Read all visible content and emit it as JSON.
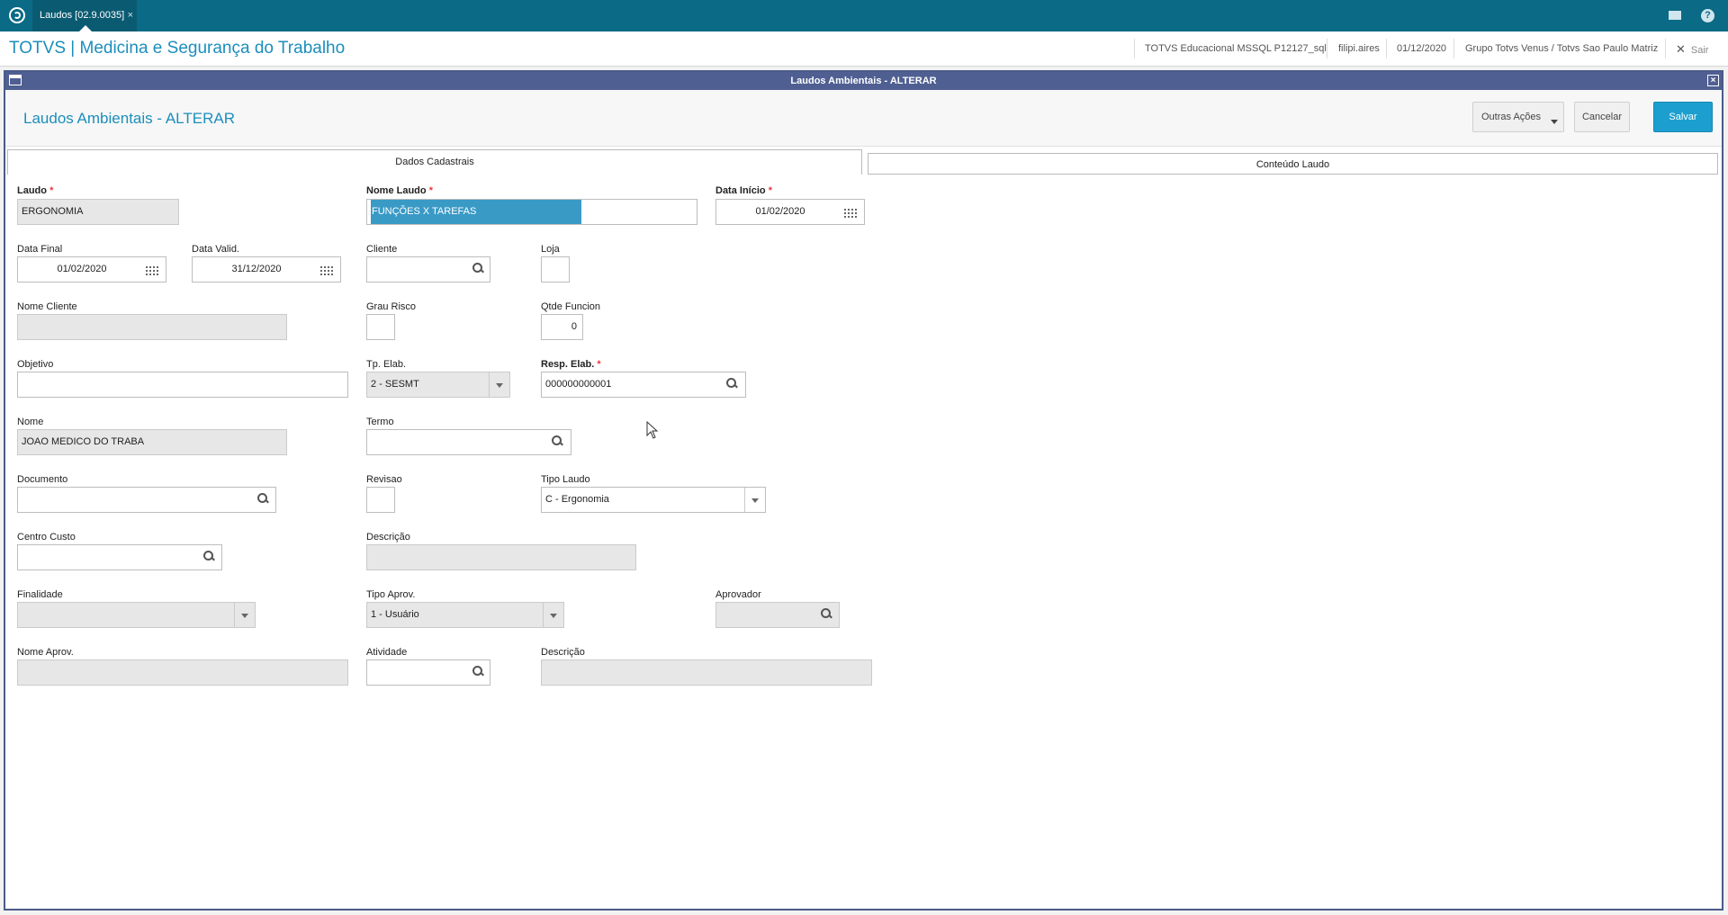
{
  "topbar": {
    "tab_label": "Laudos [02.9.0035]",
    "tab_close": "×",
    "help": "?"
  },
  "header": {
    "app_title": "TOTVS | Medicina e Segurança do Trabalho",
    "env": "TOTVS Educacional MSSQL P12127_sql",
    "user": "filipi.aires",
    "date": "01/12/2020",
    "company": "Grupo Totvs Venus / Totvs Sao Paulo Matriz",
    "exit_label": "Sair",
    "exit_x": "✕"
  },
  "window": {
    "title": "Laudos Ambientais - ALTERAR",
    "close": "×"
  },
  "page": {
    "title": "Laudos Ambientais - ALTERAR",
    "btn_outras": "Outras Ações",
    "btn_cancel": "Cancelar",
    "btn_save": "Salvar"
  },
  "tabs": {
    "dados": "Dados Cadastrais",
    "conteudo": "Conteúdo Laudo"
  },
  "form": {
    "laudo": {
      "label": "Laudo",
      "value": "ERGONOMIA"
    },
    "nome_laudo": {
      "label": "Nome Laudo",
      "value": "FUNÇÕES X TAREFAS"
    },
    "data_inicio": {
      "label": "Data Início",
      "value": "01/02/2020"
    },
    "data_final": {
      "label": "Data Final",
      "value": "01/02/2020"
    },
    "data_valid": {
      "label": "Data Valid.",
      "value": "31/12/2020"
    },
    "cliente": {
      "label": "Cliente",
      "value": ""
    },
    "loja": {
      "label": "Loja",
      "value": ""
    },
    "nome_cliente": {
      "label": "Nome Cliente",
      "value": ""
    },
    "grau_risco": {
      "label": "Grau Risco",
      "value": ""
    },
    "qtde_funcion": {
      "label": "Qtde Funcion",
      "value": "0"
    },
    "objetivo": {
      "label": "Objetivo",
      "value": ""
    },
    "tp_elab": {
      "label": "Tp. Elab.",
      "value": "2 - SESMT"
    },
    "resp_elab": {
      "label": "Resp. Elab.",
      "value": "000000000001"
    },
    "nome": {
      "label": "Nome",
      "value": "JOAO MEDICO DO TRABA"
    },
    "termo": {
      "label": "Termo",
      "value": ""
    },
    "documento": {
      "label": "Documento",
      "value": ""
    },
    "revisao": {
      "label": "Revisao",
      "value": ""
    },
    "tipo_laudo": {
      "label": "Tipo Laudo",
      "value": "C - Ergonomia"
    },
    "centro_custo": {
      "label": "Centro Custo",
      "value": ""
    },
    "descricao1": {
      "label": "Descrição",
      "value": ""
    },
    "finalidade": {
      "label": "Finalidade",
      "value": ""
    },
    "tipo_aprov": {
      "label": "Tipo Aprov.",
      "value": "1 - Usuário"
    },
    "aprovador": {
      "label": "Aprovador",
      "value": ""
    },
    "nome_aprov": {
      "label": "Nome Aprov.",
      "value": ""
    },
    "atividade": {
      "label": "Atividade",
      "value": ""
    },
    "descricao2": {
      "label": "Descrição",
      "value": ""
    }
  },
  "colors": {
    "topbar": "#0b6a85",
    "accent": "#1c8ebc",
    "window_title": "#4f5f92",
    "save": "#1c9fcf",
    "required": "#e53a3a"
  }
}
